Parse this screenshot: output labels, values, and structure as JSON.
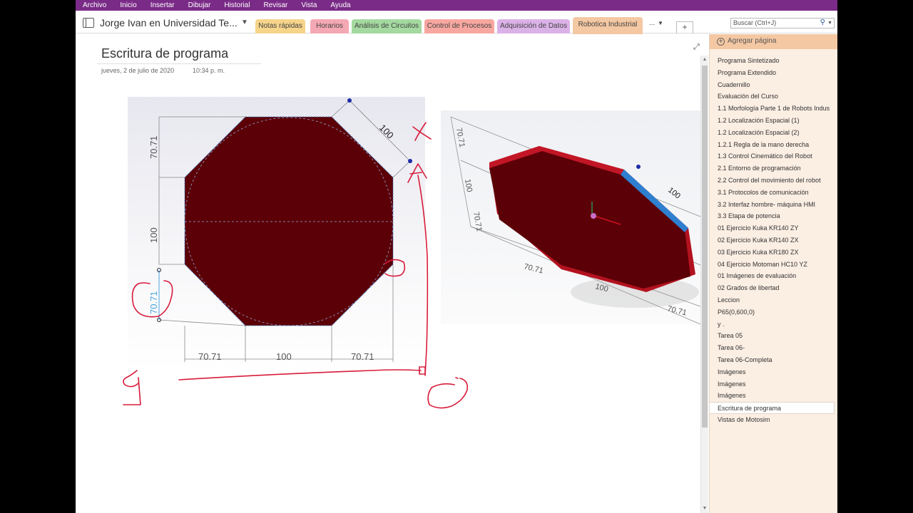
{
  "menu": [
    "Archivo",
    "Inicio",
    "Insertar",
    "Dibujar",
    "Historial",
    "Revisar",
    "Vista",
    "Ayuda"
  ],
  "notebook": {
    "title": "Jorge Ivan en Universidad Te...",
    "sections": [
      {
        "label": "Notas rápidas",
        "color": "#f6d48a"
      },
      {
        "label": "Horarios",
        "color": "#f4a8b4"
      },
      {
        "label": "Análisis de Circuitos",
        "color": "#a4d9a0"
      },
      {
        "label": "Control de Procesos",
        "color": "#f7a7a0"
      },
      {
        "label": "Adquisición de Datos",
        "color": "#dbb2e8"
      },
      {
        "label": "Robotica Industrial",
        "color": "#f4c8a3",
        "active": true
      }
    ],
    "more_label": "...",
    "add_label": "+"
  },
  "search": {
    "placeholder": "Buscar (Ctrl+J)"
  },
  "page": {
    "title": "Escritura de programa",
    "date": "jueves, 2 de julio de 2020",
    "time": "10:34 p. m."
  },
  "drawing": {
    "octagon_color": "#5c0007",
    "accent_red": "#cc1122",
    "dim_blue": "#4aa3df",
    "ink_red": "#d81b3a",
    "left_labels": {
      "top_left": "70.71",
      "mid_left": "100",
      "bottom_left": "70.71",
      "bottom_a": "70.71",
      "bottom_b": "100",
      "bottom_c": "70.71",
      "diag": "100"
    },
    "right_labels": {
      "side_a": "70.71",
      "side_b": "100",
      "side_c": "70.71",
      "bottom_a": "70.71",
      "bottom_b": "100",
      "bottom_c": "70.71",
      "diag": "100"
    }
  },
  "pages_pane": {
    "add_label": "Agregar página",
    "items": [
      "Programa Sintetizado",
      "Programa Extendido",
      "Cuadernillo",
      "Evaluación del Curso",
      "1.1 Morfología Parte 1 de Robots Indus",
      "1.2 Localización Espacial (1)",
      "1.2 Localización Espacial (2)",
      "1.2.1 Regla de la mano derecha",
      "1.3 Control Cinemático del Robot",
      "2.1 Entorno de programación",
      "2.2 Control del movimiento del robot",
      "3.1 Protocolos de comunicación",
      "3.2 Interfaz hombre- máquina HMI",
      "3.3 Etapa de potencia",
      "01 Ejercicio Kuka KR140 ZY",
      "02 Ejercicio Kuka KR140 ZX",
      "03 Ejercicio Kuka KR180 ZX",
      "04 Ejercicio Motoman HC10 YZ",
      "01 Imágenes de evaluación",
      "02 Grados de libertad",
      "Leccion",
      "P65(0,600,0)",
      "y .",
      "Tarea 05",
      "Tarea 06-",
      "Tarea 06-Completa",
      "Imágenes",
      "Imágenes",
      "Imágenes",
      "Escritura de programa",
      "Vistas de Motosim"
    ],
    "selected_index": 29
  }
}
